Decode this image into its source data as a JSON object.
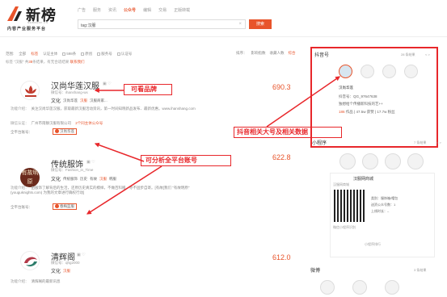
{
  "brand": {
    "name": "新榜",
    "name_en": "NEWRANK.CN",
    "slogan": "内容产业服务平台"
  },
  "topnav": [
    {
      "label": "广告",
      "active": false
    },
    {
      "label": "服务",
      "active": false
    },
    {
      "label": "资讯",
      "active": false
    },
    {
      "label": "公众号",
      "active": true
    },
    {
      "label": "编辑",
      "active": false
    },
    {
      "label": "交易",
      "active": false
    },
    {
      "label": "正版转载",
      "active": false
    }
  ],
  "search": {
    "value": "tag:汉服",
    "clear": "×",
    "button": "搜索"
  },
  "filters": {
    "label": "范围:",
    "items": [
      "全部",
      "标签",
      "认证主体"
    ],
    "selected": "标签",
    "checkboxes": [
      "598条",
      "原创",
      "服务号",
      "认证号"
    ]
  },
  "sort": {
    "label": "排序：",
    "items": [
      "影响指数",
      "收藏人数",
      "综合"
    ],
    "selected": "综合"
  },
  "result_line": {
    "prefix": "标签 \"汉服\" 共",
    "count": "38",
    "suffix": "条结果，有无合适结果",
    "link": "联系我们"
  },
  "results": [
    {
      "name": "汉尚华莲汉服",
      "wxid": "微信号：ihanshang-wx",
      "wx_tag": "原创",
      "tags_main": "文化",
      "tags": [
        {
          "text": "汉尚华莲",
          "red": false
        },
        {
          "text": "汉服",
          "red": true
        },
        {
          "text": "汉服商家...",
          "red": false
        }
      ],
      "desc_label": "功能介绍：",
      "desc": "关注汉尚华莲汉服，获取最新汉服活动资讯，第一时间知晓新品发布、最新优惠。www.ihanshang.com",
      "auth_label": "微信认证：",
      "auth": "广州市雨静汉服有限公司",
      "auth_extra": "2个同主体公众号",
      "platform_label": "全平台账号：",
      "platform_badge": "汉尚华莲",
      "score": "690.3",
      "avatar_text": "汉尚华莲"
    },
    {
      "name": "传统服饰",
      "wxid": "微信号：Fashion_in_Time",
      "wx_tag": "原创",
      "tags_main": "文化",
      "tags": [
        {
          "text": "传统服饰",
          "red": false
        },
        {
          "text": "历史",
          "red": false
        },
        {
          "text": "有故",
          "red": false
        },
        {
          "text": "汉服",
          "red": true
        },
        {
          "text": "韩服",
          "red": false
        }
      ],
      "desc_label": "功能介绍：",
      "desc": "由服饰了解背后的生活，还原历史真实的模样，不做百科搬，亦不固步自寄。[有故]我们 \"有故明原\" (youguknights.com) 为我的文章进行确权行动]",
      "platform_label": "全平台账号：",
      "platform_badge": "春梅蓝服",
      "score": "622.8",
      "avatar_text": "有故明原"
    },
    {
      "name": "清辉阁",
      "wxid": "微信号：qhg2000",
      "tags_main": "文化",
      "tags": [
        {
          "text": "汉服",
          "red": true
        }
      ],
      "desc_label": "功能介绍：",
      "desc": "清辉阁的最新讯息",
      "score": "612.0"
    }
  ],
  "douyin_panel": {
    "title": "抖音号",
    "meta": "28 条结果",
    "nav": "< >",
    "account_name": "汉尚华莲",
    "id": "抖音号：QG_97647638",
    "intro": "独想给个传播新科技的艺++",
    "stats_prefix": "186",
    "stats": "作品 | 47.5w 获赞 | 17.7w 粉丝"
  },
  "mini_panel": {
    "title": "小程序",
    "meta": "7 条结果",
    "nav": "< >",
    "mini_name": "汉服网商城",
    "mini_sub": "汉服网商城",
    "mini_info1": "类别：服饰箱/帽包",
    "mini_info2": "送资公众号数：1",
    "mini_info3": "上线时长：–",
    "qr_caption": "微信小程序识别",
    "more_link": "小程序排行"
  },
  "weibo_panel": {
    "title": "微博",
    "meta": "3 条结果"
  },
  "annotations": {
    "brand_label": "可看品牌",
    "douyin_label": "抖音相关大号及相关数据",
    "platform_label": "可分析全平台账号"
  },
  "colors": {
    "brand": "#e8542b",
    "annotation": "#e8272b"
  }
}
